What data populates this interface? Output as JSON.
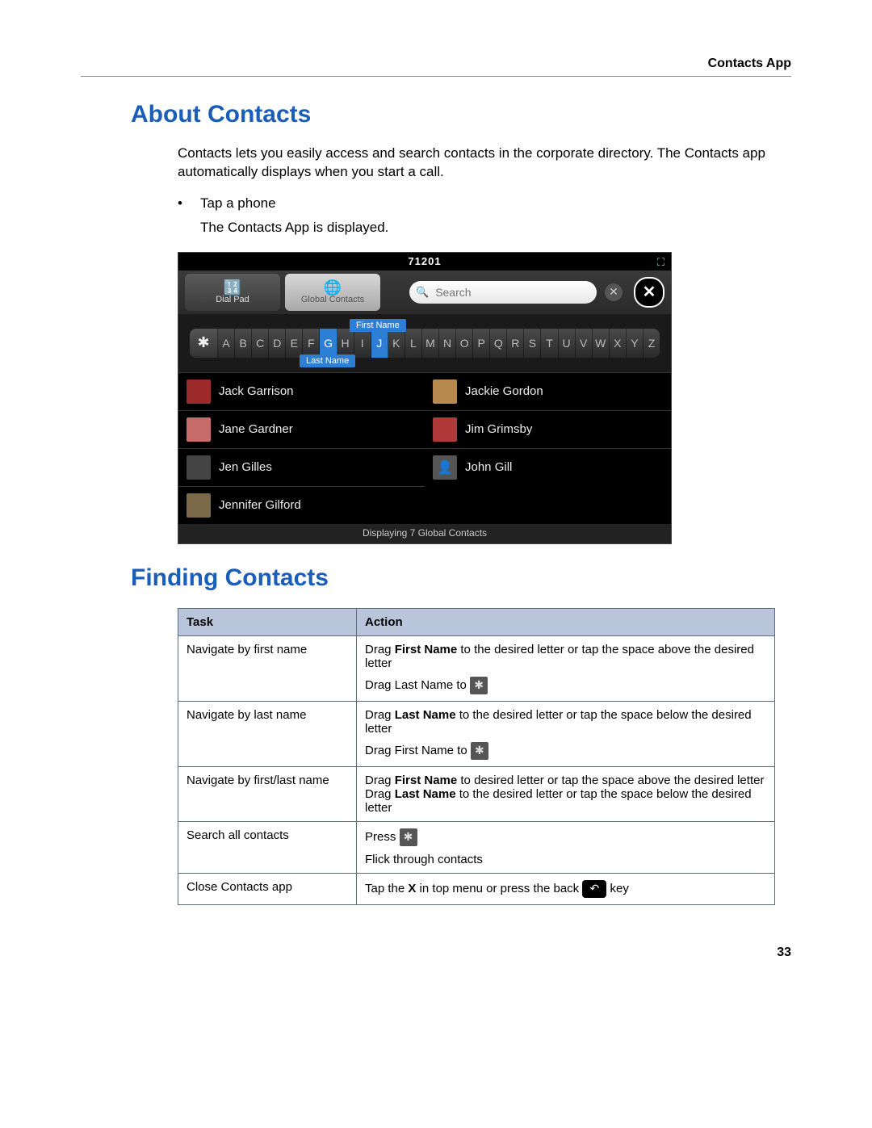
{
  "header": {
    "running": "Contacts App"
  },
  "section1": {
    "title": "About Contacts",
    "intro": "Contacts lets you easily access and search contacts in the corporate directory. The Contacts app automatically displays when you start a call.",
    "bullet": "Tap a phone",
    "sub": "The Contacts App is displayed."
  },
  "screenshot": {
    "status_number": "71201",
    "tabs": {
      "dialpad": "Dial Pad",
      "global": "Global Contacts"
    },
    "search_placeholder": "Search",
    "chip_first": "First Name",
    "chip_last": "Last Name",
    "alphabet": [
      "✱",
      "A",
      "B",
      "C",
      "D",
      "E",
      "F",
      "G",
      "H",
      "I",
      "J",
      "K",
      "L",
      "M",
      "N",
      "O",
      "P",
      "Q",
      "R",
      "S",
      "T",
      "U",
      "V",
      "W",
      "X",
      "Y",
      "Z"
    ],
    "highlight_first": "J",
    "highlight_last": "G",
    "contacts": [
      {
        "name": "Jack Garrison",
        "avatar": "c1"
      },
      {
        "name": "Jackie Gordon",
        "avatar": "c2"
      },
      {
        "name": "Jane Gardner",
        "avatar": "c3"
      },
      {
        "name": "Jim Grimsby",
        "avatar": "c4"
      },
      {
        "name": "Jen Gilles",
        "avatar": "c5"
      },
      {
        "name": "John Gill",
        "avatar": "placeholder"
      },
      {
        "name": "Jennifer Gilford",
        "avatar": "c7"
      }
    ],
    "footer": "Displaying 7 Global Contacts"
  },
  "section2": {
    "title": "Finding Contacts"
  },
  "table": {
    "headers": {
      "task": "Task",
      "action": "Action"
    },
    "rows": {
      "r1": {
        "task": "Navigate by first name",
        "p1a": "Drag ",
        "p1b": "First Name",
        "p1c": " to the desired letter or tap the space above the desired letter",
        "p2": "Drag Last Name to"
      },
      "r2": {
        "task": "Navigate by last name",
        "p1a": "Drag ",
        "p1b": "Last Name",
        "p1c": " to the desired letter or tap the space below the desired letter",
        "p2": "Drag First Name to"
      },
      "r3": {
        "task": "Navigate by first/last name",
        "p1a": "Drag ",
        "p1b": "First Name",
        "p1c": " to desired letter or tap the space above the desired letter",
        "p2a": "Drag ",
        "p2b": "Last Name",
        "p2c": " to the desired letter or tap the space below the desired letter"
      },
      "r4": {
        "task": "Search all contacts",
        "p1": "Press",
        "p2": "Flick through contacts"
      },
      "r5": {
        "task": "Close Contacts app",
        "p1a": "Tap the ",
        "p1b": "X",
        "p1c": " in top menu or press the back",
        "p1d": "key"
      }
    }
  },
  "page_number": "33"
}
